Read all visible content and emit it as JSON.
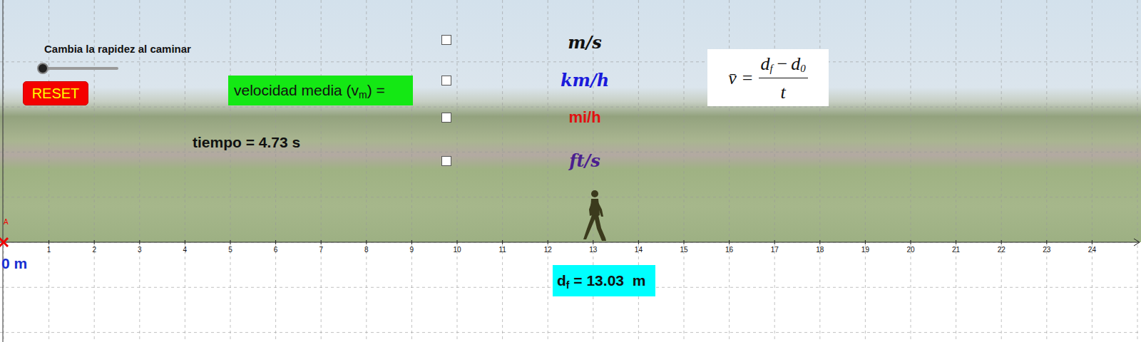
{
  "slider": {
    "label": "Cambia la rapidez al caminar",
    "level": 0
  },
  "reset_button": "RESET",
  "velocity_label": {
    "text": "velocidad media (v",
    "sub": "m",
    "after": ") ="
  },
  "units": [
    {
      "label": "m/s",
      "checked": false,
      "color": "#111111",
      "kind": "math"
    },
    {
      "label": "km/h",
      "checked": false,
      "color": "#1a1adb",
      "kind": "math"
    },
    {
      "label": "mi/h",
      "checked": false,
      "color": "#e01010",
      "kind": "text"
    },
    {
      "label": "ft/s",
      "checked": false,
      "color": "#4b1f8f",
      "kind": "math"
    }
  ],
  "formula": {
    "lhs": "v̄",
    "eq": "=",
    "a": "d",
    "a_sub": "f",
    "op": "−",
    "b": "d",
    "b_sub": "0",
    "denominator": "t"
  },
  "time": "tiempo = 4.73 s",
  "axis": {
    "origin_label": "0 m",
    "point_label": "A",
    "ticks": [
      "1",
      "2",
      "3",
      "4",
      "5",
      "6",
      "7",
      "8",
      "9",
      "10",
      "11",
      "12",
      "13",
      "14",
      "15",
      "16",
      "17",
      "18",
      "19",
      "20",
      "21",
      "22",
      "23",
      "24"
    ]
  },
  "walker": {
    "level": 0.521
  },
  "distance": {
    "symbol": "d",
    "sub": "f",
    "value": " = 13.03  m"
  }
}
